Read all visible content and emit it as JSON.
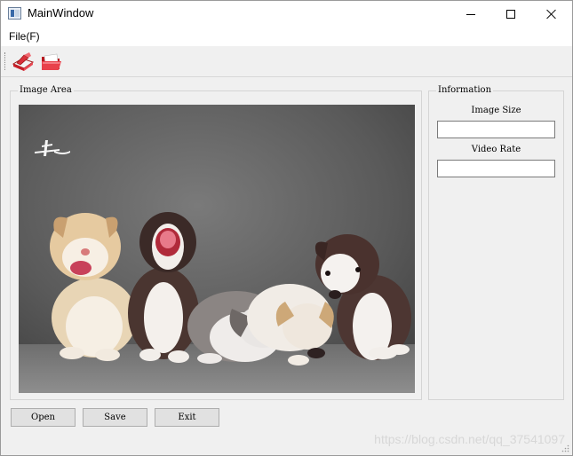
{
  "window": {
    "title": "MainWindow"
  },
  "menu": {
    "file": "File(F)"
  },
  "toolbar": {
    "save_icon": "save-icon",
    "open_icon": "open-folder-icon"
  },
  "image_area": {
    "title": "Image Area",
    "image": "photo of five puppies on a grey background"
  },
  "information": {
    "title": "Information",
    "image_size_label": "Image Size",
    "image_size_value": "",
    "video_rate_label": "Video Rate",
    "video_rate_value": ""
  },
  "buttons": {
    "open": "Open",
    "save": "Save",
    "exit": "Exit"
  },
  "watermark": "https://blog.csdn.net/qq_37541097",
  "colors": {
    "window_bg": "#f0f0f0",
    "title_bg": "#ffffff",
    "button_bg": "#e1e1e1"
  }
}
